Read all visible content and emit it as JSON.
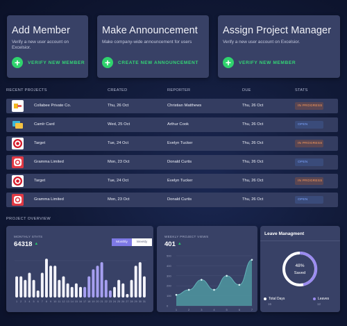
{
  "cards": [
    {
      "title": "Add Member",
      "description": "Verify a new user account on Excelsior.",
      "action": "VERIFY NEW MEMBER"
    },
    {
      "title": "Make Announcement",
      "description": "Make company-wide announcement for users",
      "action": "CREATE NEW ANNOUNCEMENT"
    },
    {
      "title": "Assign Project Manager",
      "description": "Verify a new user account on Excelsior.",
      "action": "VERIFY NEW MEMBER"
    }
  ],
  "table": {
    "headers": {
      "project": "RECENT PROJECTS",
      "created": "CREATED",
      "reporter": "REPORTER",
      "due": "DUE",
      "stats": "STATS"
    },
    "rows": [
      {
        "logo": "collabee-logo",
        "name": "Collabee Private Co.",
        "created": "Thu, 26 Oct",
        "reporter": "Christian Matthews",
        "due": "Thu, 26 Oct",
        "status": "IN PROGRESS"
      },
      {
        "logo": "camlr-logo",
        "name": "Camlr Card",
        "created": "Wed, 25 Oct",
        "reporter": "Arthur Cook",
        "due": "Thu, 26 Oct",
        "status": "OPEN"
      },
      {
        "logo": "target-logo",
        "name": "Target",
        "created": "Tue, 24 Oct",
        "reporter": "Evelyn Tucker",
        "due": "Thu, 26 Oct",
        "status": "IN PROGRESS"
      },
      {
        "logo": "gramma-logo",
        "name": "Gramma Limited",
        "created": "Mon, 23 Oct",
        "reporter": "Donald Curtis",
        "due": "Thu, 26 Oct",
        "status": "OPEN"
      },
      {
        "logo": "target-logo",
        "name": "Target",
        "created": "Tue, 24 Oct",
        "reporter": "Evelyn Tucker",
        "due": "Thu, 26 Oct",
        "status": "IN PROGRESS"
      },
      {
        "logo": "gramma-logo",
        "name": "Gramma Limited",
        "created": "Mon, 23 Oct",
        "reporter": "Donald Curtis",
        "due": "Thu, 26 Oct",
        "status": "OPEN"
      }
    ]
  },
  "overview": {
    "title": "PROJECT OVERVIEW",
    "monthly": {
      "label": "MONTHLY STATS",
      "value": "64318",
      "toggle_on": "Monthly",
      "toggle_off": "Weekly"
    },
    "weekly": {
      "label": "WEEKLY PROJECT VIEWS",
      "value": "401"
    },
    "leave": {
      "title": "Leave Managment",
      "percent": "48%",
      "caption": "Saved",
      "legend": [
        {
          "label": "Total Days",
          "value": "16"
        },
        {
          "label": "Leaves",
          "value": "12"
        }
      ]
    }
  },
  "colors": {
    "accent": "#7e79e6",
    "green": "#2fd36d",
    "in_progress": "#ff9c5a",
    "open": "#7fa6ff",
    "teal": "#4f98a0"
  },
  "chart_data": [
    {
      "type": "bar",
      "title": "MONTHLY STATS",
      "categories": [
        "1",
        "2",
        "3",
        "4",
        "5",
        "6",
        "7",
        "8",
        "9",
        "10",
        "11",
        "12",
        "13",
        "14",
        "15",
        "16",
        "17",
        "18",
        "19",
        "20",
        "21",
        "22",
        "23",
        "24",
        "25",
        "26",
        "27",
        "28",
        "29",
        "30",
        "31"
      ],
      "values": [
        6,
        6,
        5,
        7,
        5,
        2,
        7,
        11,
        9,
        9,
        5,
        6,
        4,
        3,
        4,
        3,
        3,
        6,
        8,
        9,
        10,
        5,
        2,
        3,
        5,
        4,
        1,
        5,
        9,
        10,
        6
      ],
      "highlight": [
        16,
        17,
        18,
        19,
        20,
        21,
        22
      ],
      "ylim": [
        0,
        12
      ]
    },
    {
      "type": "area",
      "title": "WEEKLY PROJECT VIEWS",
      "x": [
        "1",
        "2",
        "3",
        "4",
        "5",
        "6",
        "7"
      ],
      "values": [
        110,
        160,
        260,
        160,
        300,
        210,
        460
      ],
      "yticks": [
        "0",
        "100",
        "200",
        "300",
        "400",
        "500"
      ],
      "ylim": [
        0,
        500
      ]
    }
  ]
}
